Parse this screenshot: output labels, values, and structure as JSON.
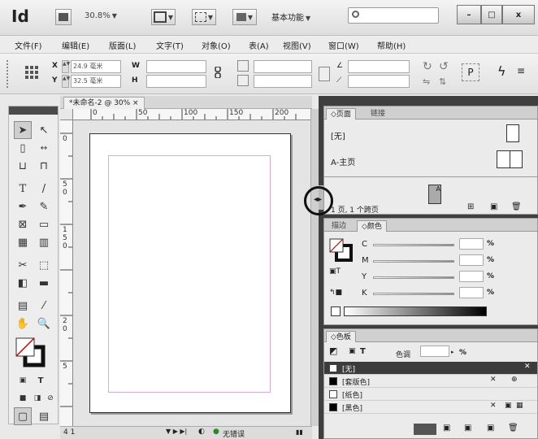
{
  "app": {
    "logo": "Id",
    "zoom": "30.8%",
    "workspace": "基本功能",
    "search_placeholder": ""
  },
  "window_controls": {
    "minimize": "–",
    "maximize": "□",
    "close": "x"
  },
  "menu": [
    "文件(F)",
    "编辑(E)",
    "版面(L)",
    "文字(T)",
    "对象(O)",
    "表(A)",
    "视图(V)",
    "窗口(W)",
    "帮助(H)"
  ],
  "control_bar": {
    "x_label": "X",
    "y_label": "Y",
    "x_value": "24.9 毫米",
    "y_value": "32.5 毫米",
    "w_label": "W",
    "h_label": "H",
    "p_label": "P"
  },
  "document": {
    "tab_label": "*未命名-2 @ 30% ×",
    "ruler_top_ticks": [
      "0",
      "50",
      "100",
      "150",
      "200"
    ],
    "ruler_left_ticks": [
      "0",
      "5",
      "0",
      "1",
      "5",
      "0",
      "2",
      "0",
      "5"
    ],
    "status_page": "4 1",
    "status_errors": "无错误"
  },
  "pages_panel": {
    "tab_pages": "◇页面",
    "tab_links": "链接",
    "none_label": "[无]",
    "master_label": "A-主页",
    "page_icon_label": "A",
    "footer": "1 页, 1 个跨页"
  },
  "color_panel": {
    "tab_stroke": "描边",
    "tab_color": "◇颜色",
    "rows": [
      {
        "label": "C",
        "pct": "%"
      },
      {
        "label": "M",
        "pct": "%"
      },
      {
        "label": "Y",
        "pct": "%"
      },
      {
        "label": "K",
        "pct": "%"
      }
    ]
  },
  "swatches_panel": {
    "title": "◇色板",
    "tint_label": "色调",
    "tint_pct": "%",
    "t_label": "T",
    "items": [
      "[无]",
      "[套版色]",
      "[纸色]",
      "[黑色]"
    ]
  }
}
